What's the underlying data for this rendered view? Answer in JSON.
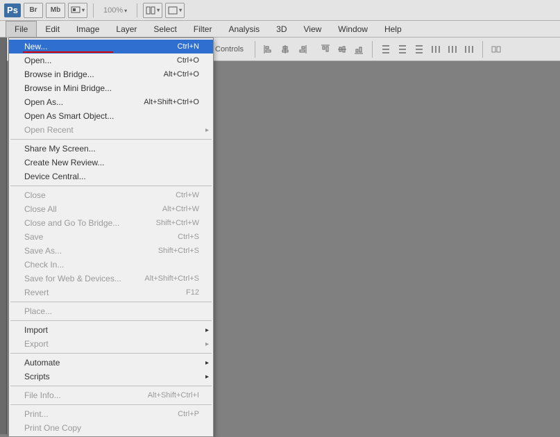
{
  "top": {
    "logo": "Ps",
    "btn_br": "Br",
    "btn_mb": "Mb",
    "zoom": "100%"
  },
  "menubar": {
    "file": "File",
    "edit": "Edit",
    "image": "Image",
    "layer": "Layer",
    "select": "Select",
    "filter": "Filter",
    "analysis": "Analysis",
    "threeD": "3D",
    "view": "View",
    "window": "Window",
    "help": "Help"
  },
  "options": {
    "controls": "Controls"
  },
  "filemenu": {
    "new_label": "New...",
    "new_sc": "Ctrl+N",
    "open_label": "Open...",
    "open_sc": "Ctrl+O",
    "browse_bridge": "Browse in Bridge...",
    "browse_bridge_sc": "Alt+Ctrl+O",
    "browse_mini": "Browse in Mini Bridge...",
    "open_as": "Open As...",
    "open_as_sc": "Alt+Shift+Ctrl+O",
    "open_smart": "Open As Smart Object...",
    "open_recent": "Open Recent",
    "share_screen": "Share My Screen...",
    "create_review": "Create New Review...",
    "device_central": "Device Central...",
    "close": "Close",
    "close_sc": "Ctrl+W",
    "close_all": "Close All",
    "close_all_sc": "Alt+Ctrl+W",
    "close_bridge": "Close and Go To Bridge...",
    "close_bridge_sc": "Shift+Ctrl+W",
    "save": "Save",
    "save_sc": "Ctrl+S",
    "save_as": "Save As...",
    "save_as_sc": "Shift+Ctrl+S",
    "check_in": "Check In...",
    "save_web": "Save for Web & Devices...",
    "save_web_sc": "Alt+Shift+Ctrl+S",
    "revert": "Revert",
    "revert_sc": "F12",
    "place": "Place...",
    "import": "Import",
    "export": "Export",
    "automate": "Automate",
    "scripts": "Scripts",
    "file_info": "File Info...",
    "file_info_sc": "Alt+Shift+Ctrl+I",
    "print": "Print...",
    "print_sc": "Ctrl+P",
    "print_one": "Print One Copy"
  }
}
